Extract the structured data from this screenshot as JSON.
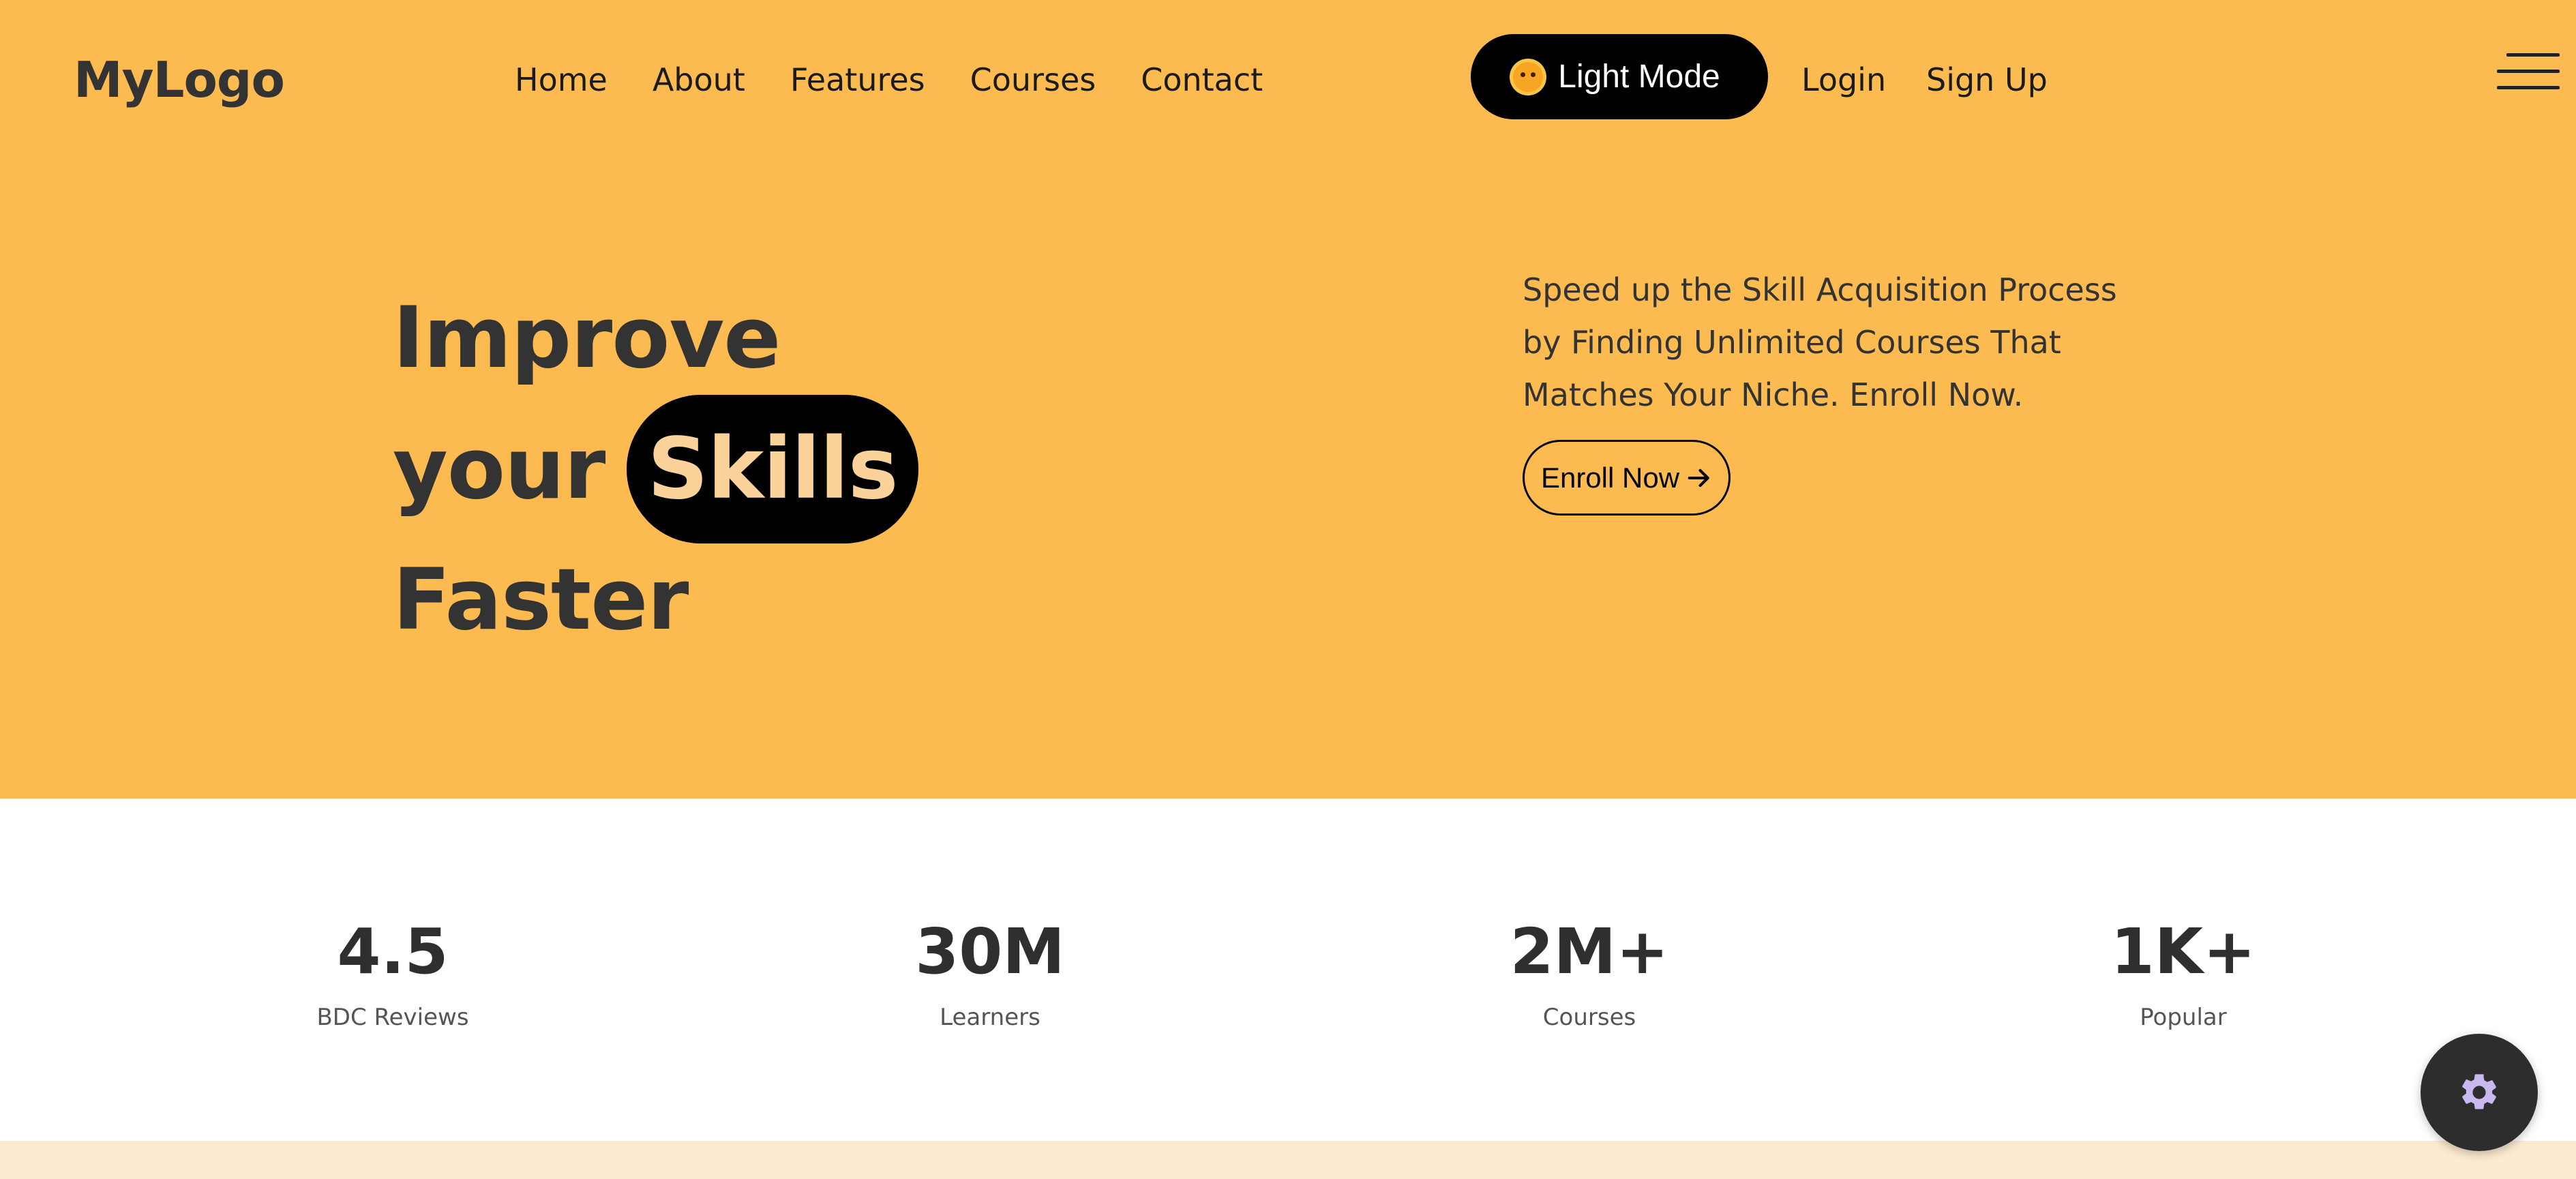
{
  "header": {
    "logo": "MyLogo",
    "nav": [
      "Home",
      "About",
      "Features",
      "Courses",
      "Contact"
    ],
    "theme_toggle_label": "Light Mode",
    "login_label": "Login",
    "signup_label": "Sign Up"
  },
  "hero": {
    "headline_line1": "Improve",
    "headline_line2_prefix": "your",
    "headline_highlight": "Skills",
    "headline_line3": "Faster",
    "description": "Speed up the Skill Acquisition Process by Finding Unlimited Courses That Matches Your Niche. Enroll Now.",
    "cta_label": "Enroll Now"
  },
  "stats": [
    {
      "value": "4.5",
      "label": "BDC Reviews"
    },
    {
      "value": "30M",
      "label": "Learners"
    },
    {
      "value": "2M+",
      "label": "Courses"
    },
    {
      "value": "1K+",
      "label": "Popular"
    }
  ],
  "colors": {
    "hero_bg": "#fbbb51",
    "accent_dark": "#000000",
    "highlight_text": "#fbd39a",
    "bottom_band": "#fdebd1"
  },
  "icons": {
    "theme_toggle": "smiling-sun-icon",
    "cta": "arrow-right-icon",
    "menu": "hamburger-menu-icon",
    "settings": "gear-icon"
  }
}
